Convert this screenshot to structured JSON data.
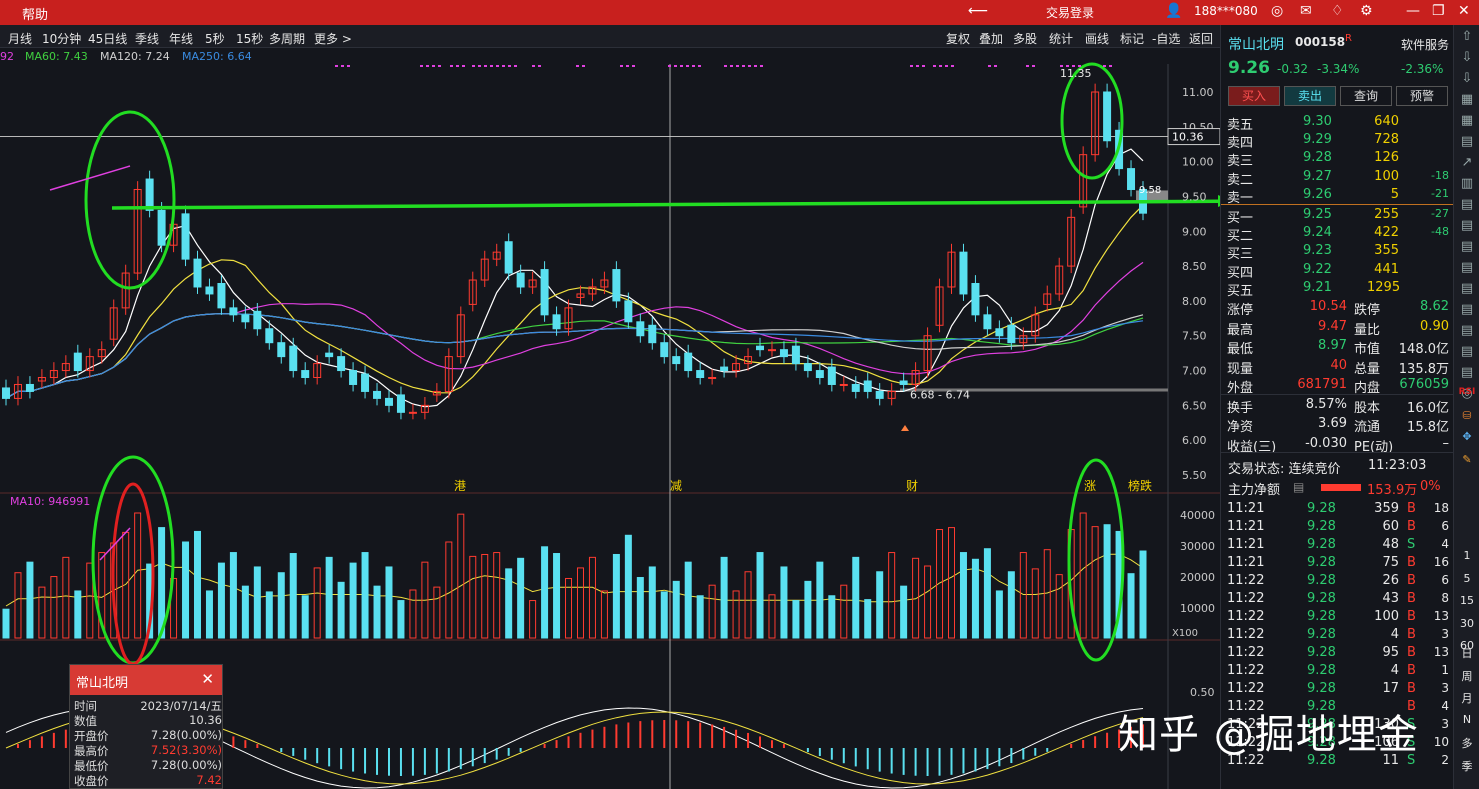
{
  "titlebar": {
    "help": "帮助",
    "back_icon": "back-arrow-icon",
    "login": "交易登录",
    "user": "188***080"
  },
  "toolbar": {
    "periods": [
      "月线",
      "10分钟",
      "45日线",
      "季线",
      "年线",
      "5秒",
      "15秒",
      "多周期",
      "更多 >"
    ],
    "right": [
      "复权",
      "叠加",
      "多股",
      "统计",
      "画线",
      "标记",
      "-自选",
      "返回"
    ]
  },
  "ma_legend": {
    "prefix": "92",
    "ma60": "MA60: 7.43",
    "ma120": "MA120: 7.24",
    "ma250": "MA250: 6.64"
  },
  "price_axis": [
    "11.00",
    "10.50",
    "10.00",
    "9.50",
    "9.00",
    "8.50",
    "8.00",
    "7.50",
    "7.00",
    "6.50",
    "6.00",
    "5.50"
  ],
  "price_markers": {
    "crosshair": "10.36",
    "high_label": "11.35",
    "current": "9.58",
    "low_label": "6.68 - 6.74"
  },
  "event_marks": [
    "港",
    "减",
    "财",
    "涨",
    "榜跌"
  ],
  "volume": {
    "legend": "MA10: 946991",
    "axis": [
      "40000",
      "30000",
      "20000",
      "10000"
    ],
    "unit": "X100"
  },
  "indicator": {
    "axis": "0.50"
  },
  "stock": {
    "name": "常山北明",
    "code": "000158",
    "badge": "R",
    "service": "软件服务",
    "price": "9.26",
    "change": "-0.32",
    "pct": "-3.34%",
    "sector_pct": "-2.36%"
  },
  "buttons": {
    "buy": "买入",
    "sell": "卖出",
    "query": "查询",
    "alert": "预警"
  },
  "asks": [
    {
      "l": "卖五",
      "p": "9.30",
      "v": "640",
      "d": ""
    },
    {
      "l": "卖四",
      "p": "9.29",
      "v": "728",
      "d": ""
    },
    {
      "l": "卖三",
      "p": "9.28",
      "v": "126",
      "d": ""
    },
    {
      "l": "卖二",
      "p": "9.27",
      "v": "100",
      "d": "-18"
    },
    {
      "l": "卖一",
      "p": "9.26",
      "v": "5",
      "d": "-21"
    }
  ],
  "bids": [
    {
      "l": "买一",
      "p": "9.25",
      "v": "255",
      "d": "-27"
    },
    {
      "l": "买二",
      "p": "9.24",
      "v": "422",
      "d": "-48"
    },
    {
      "l": "买三",
      "p": "9.23",
      "v": "355",
      "d": ""
    },
    {
      "l": "买四",
      "p": "9.22",
      "v": "441",
      "d": ""
    },
    {
      "l": "买五",
      "p": "9.21",
      "v": "1295",
      "d": ""
    }
  ],
  "stats": [
    {
      "a": "涨停",
      "av": "10.54",
      "b": "跌停",
      "bv": "8.62"
    },
    {
      "a": "最高",
      "av": "9.47",
      "b": "量比",
      "bv": "0.90"
    },
    {
      "a": "最低",
      "av": "8.97",
      "b": "市值",
      "bv": "148.0亿"
    },
    {
      "a": "现量",
      "av": "40",
      "b": "总量",
      "bv": "135.8万"
    },
    {
      "a": "外盘",
      "av": "681791",
      "b": "内盘",
      "bv": "676059"
    },
    {
      "a": "换手",
      "av": "8.57%",
      "b": "股本",
      "bv": "16.0亿"
    },
    {
      "a": "净资",
      "av": "3.69",
      "b": "流通",
      "bv": "15.8亿"
    },
    {
      "a": "收益(三)",
      "av": "-0.030",
      "b": "PE(动)",
      "bv": "–"
    }
  ],
  "status": {
    "label": "交易状态: 连续竞价",
    "time": "11:23:03",
    "fund_label": "主力净额",
    "fund_value": "153.9万",
    "fund_pct": "0%"
  },
  "ticks": [
    {
      "t": "11:21",
      "p": "9.28",
      "v": "359",
      "s": "B",
      "n": "18"
    },
    {
      "t": "11:21",
      "p": "9.28",
      "v": "60",
      "s": "B",
      "n": "6"
    },
    {
      "t": "11:21",
      "p": "9.28",
      "v": "48",
      "s": "S",
      "n": "4"
    },
    {
      "t": "11:21",
      "p": "9.28",
      "v": "75",
      "s": "B",
      "n": "16"
    },
    {
      "t": "11:22",
      "p": "9.28",
      "v": "26",
      "s": "B",
      "n": "6"
    },
    {
      "t": "11:22",
      "p": "9.28",
      "v": "43",
      "s": "B",
      "n": "8"
    },
    {
      "t": "11:22",
      "p": "9.28",
      "v": "100",
      "s": "B",
      "n": "13"
    },
    {
      "t": "11:22",
      "p": "9.28",
      "v": "4",
      "s": "B",
      "n": "3"
    },
    {
      "t": "11:22",
      "p": "9.28",
      "v": "95",
      "s": "B",
      "n": "13"
    },
    {
      "t": "11:22",
      "p": "9.28",
      "v": "4",
      "s": "B",
      "n": "1"
    },
    {
      "t": "11:22",
      "p": "9.28",
      "v": "17",
      "s": "B",
      "n": "3"
    },
    {
      "t": "11:22",
      "p": "9.28",
      "v": "",
      "s": "B",
      "n": "4"
    },
    {
      "t": "11:22",
      "p": "9.28",
      "v": "130",
      "s": "S",
      "n": "3"
    },
    {
      "t": "11:22",
      "p": "9.28",
      "v": "106",
      "s": "S",
      "n": "10"
    },
    {
      "t": "11:22",
      "p": "9.28",
      "v": "11",
      "s": "S",
      "n": "2"
    }
  ],
  "tooltip": {
    "title": "常山北明",
    "rows": [
      {
        "k": "时间",
        "v": "2023/07/14/五"
      },
      {
        "k": "数值",
        "v": "10.36"
      },
      {
        "k": "开盘价",
        "v": "7.28(0.00%)"
      },
      {
        "k": "最高价",
        "v": "7.52(3.30%)"
      },
      {
        "k": "最低价",
        "v": "7.28(0.00%)"
      },
      {
        "k": "收盘价",
        "v": "7.42"
      }
    ]
  },
  "sidebar": [
    "日",
    "周",
    "月",
    "N",
    "多",
    "季"
  ],
  "sidebar_numbers": [
    "1",
    "5",
    "15",
    "30",
    "60"
  ],
  "watermark": "知乎 @掘地埋金",
  "colors": {
    "up": "#ff3b30",
    "down": "#5ae0f0",
    "ma5": "#ffffff",
    "ma10": "#f0e040",
    "ma20": "#e040e0",
    "ma60": "#40d040",
    "annotation": "#22dd22"
  }
}
